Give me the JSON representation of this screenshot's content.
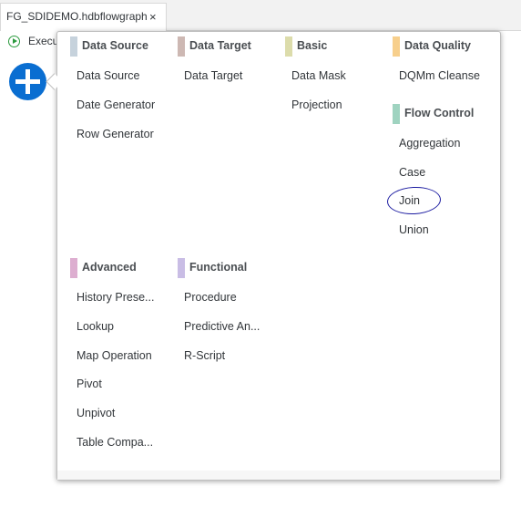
{
  "tab": {
    "title": "FG_SDIDEMO.hdbflowgraph",
    "close_label": "×"
  },
  "toolbar": {
    "execute_label": "Execu"
  },
  "categories": {
    "data_source": {
      "title": "Data Source",
      "color": "#c6d2dc",
      "items": [
        "Data Source",
        "Date Generator",
        "Row Generator"
      ]
    },
    "data_target": {
      "title": "Data Target",
      "color": "#cdb8b3",
      "items": [
        "Data Target"
      ]
    },
    "basic": {
      "title": "Basic",
      "color": "#dcdcab",
      "items": [
        "Data Mask",
        "Projection"
      ]
    },
    "data_quality": {
      "title": "Data Quality",
      "color": "#f7cf8c",
      "items": [
        "DQMm Cleanse"
      ]
    },
    "flow_control": {
      "title": "Flow Control",
      "color": "#9fd3c0",
      "items": [
        "Aggregation",
        "Case",
        "Join",
        "Union"
      ]
    },
    "advanced": {
      "title": "Advanced",
      "color": "#ddaed0",
      "items": [
        "History Prese...",
        "Lookup",
        "Map Operation",
        "Pivot",
        "Unpivot",
        "Table Compa..."
      ]
    },
    "functional": {
      "title": "Functional",
      "color": "#c9bde5",
      "items": [
        "Procedure",
        "Predictive An...",
        "R-Script"
      ]
    }
  }
}
